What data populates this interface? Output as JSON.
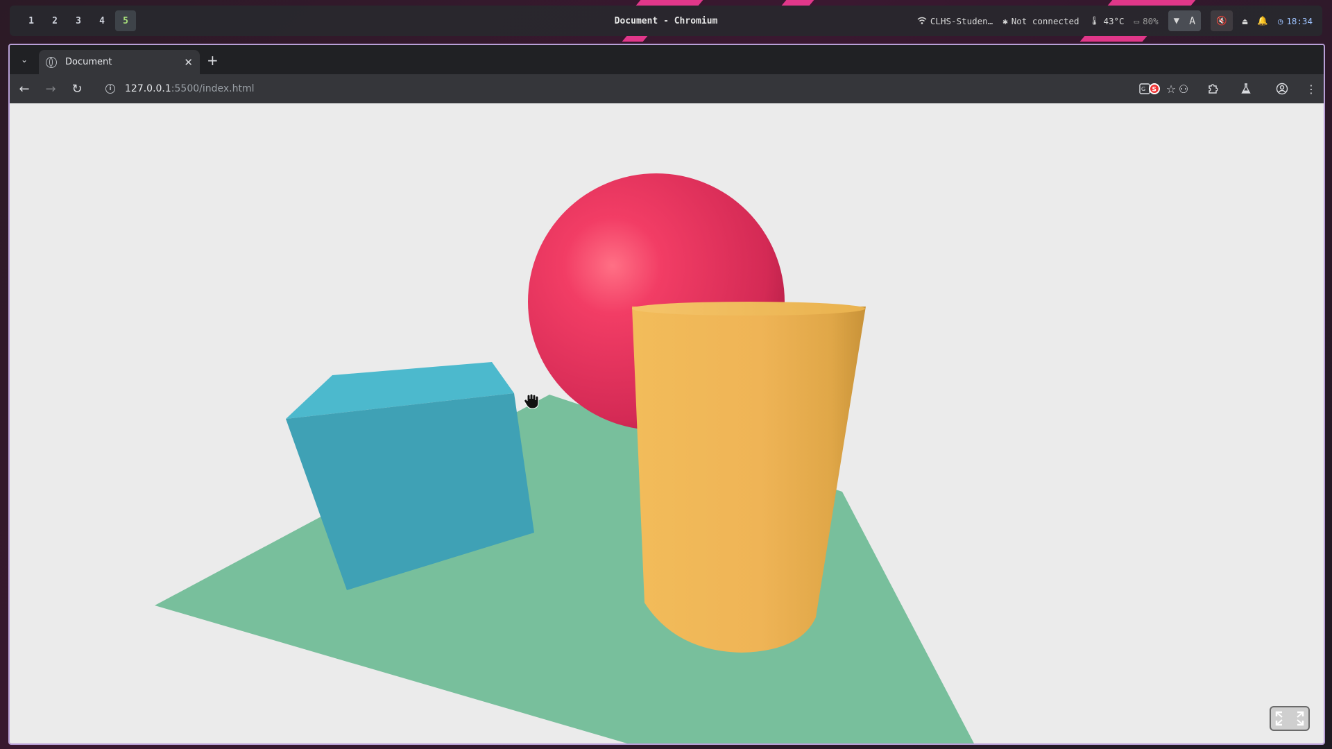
{
  "topbar": {
    "workspaces": [
      "1",
      "2",
      "3",
      "4",
      "5"
    ],
    "window_title": "Document - Chromium",
    "wifi": "CLHS-Studen…",
    "bluetooth": "Not connected",
    "temperature": "43°C",
    "battery": "80%",
    "keyboard_layout": "A",
    "time": "18:34"
  },
  "browser": {
    "tab_title": "Document",
    "url_host": "127.0.0.1",
    "url_path": ":5500/index.html"
  },
  "scene": {
    "background": "#ebebeb",
    "plane_color": "#78bf9c",
    "box_color": "#3fa1b5",
    "sphere_color": "#e83862",
    "cylinder_color": "#f0b653"
  },
  "colors": {
    "active_workspace": "#a8e07a",
    "window_border": "#b9a0d8",
    "clock": "#9ec3ff"
  }
}
